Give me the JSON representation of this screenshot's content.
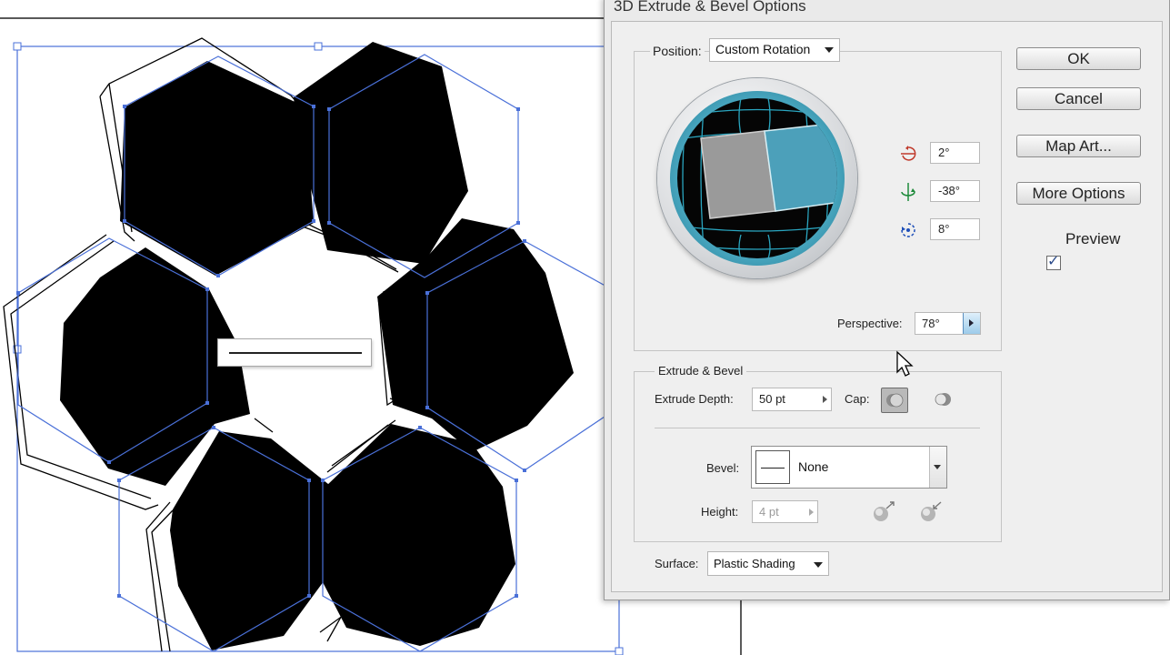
{
  "dialog": {
    "title": "3D Extrude & Bevel Options",
    "position": {
      "label": "Position:",
      "value": "Custom Rotation"
    },
    "rotation": {
      "x_angle": "2°",
      "y_angle": "-38°",
      "z_angle": "8°"
    },
    "perspective": {
      "label": "Perspective:",
      "value": "78°"
    },
    "extrude_bevel": {
      "section_label": "Extrude & Bevel",
      "extrude_depth_label": "Extrude Depth:",
      "extrude_depth_value": "50 pt",
      "cap_label": "Cap:",
      "bevel_label": "Bevel:",
      "bevel_value": "None",
      "height_label": "Height:",
      "height_value": "4 pt"
    },
    "surface": {
      "label": "Surface:",
      "value": "Plastic Shading"
    },
    "buttons": {
      "ok": "OK",
      "cancel": "Cancel",
      "map_art": "Map Art...",
      "more_options": "More Options"
    },
    "preview": {
      "label": "Preview",
      "checked": true
    }
  },
  "colors": {
    "selection": "#4a70d8",
    "trackball_front": "#4ca0ba",
    "trackball_side": "#999999",
    "dialog_bg": "#eaeaea"
  },
  "icons": [
    "x-rotation-icon",
    "y-rotation-icon",
    "z-rotation-icon",
    "cap-on-icon",
    "cap-off-icon",
    "bevel-extent-in-icon",
    "bevel-extent-out-icon",
    "mouse-cursor-icon"
  ]
}
